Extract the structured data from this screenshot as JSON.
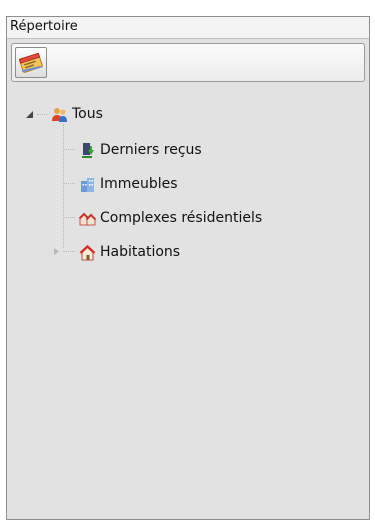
{
  "panel": {
    "title": "Répertoire"
  },
  "toolbar": {
    "buttons": [
      {
        "icon": "address-book-icon"
      }
    ]
  },
  "tree": {
    "root": {
      "label": "Tous",
      "icon": "people-icon",
      "expanded": true
    },
    "children": [
      {
        "label": "Derniers reçus",
        "icon": "received-download-icon",
        "expandable": false
      },
      {
        "label": "Immeubles",
        "icon": "building-icon",
        "expandable": false
      },
      {
        "label": "Complexes résidentiels",
        "icon": "residential-complex-icon",
        "expandable": false
      },
      {
        "label": "Habitations",
        "icon": "house-icon",
        "expandable": true,
        "expanded": false
      }
    ]
  },
  "colors": {
    "panel_background": "#e2e2e2",
    "title_background": "#f4f4f4",
    "border": "#8f8f8f"
  }
}
